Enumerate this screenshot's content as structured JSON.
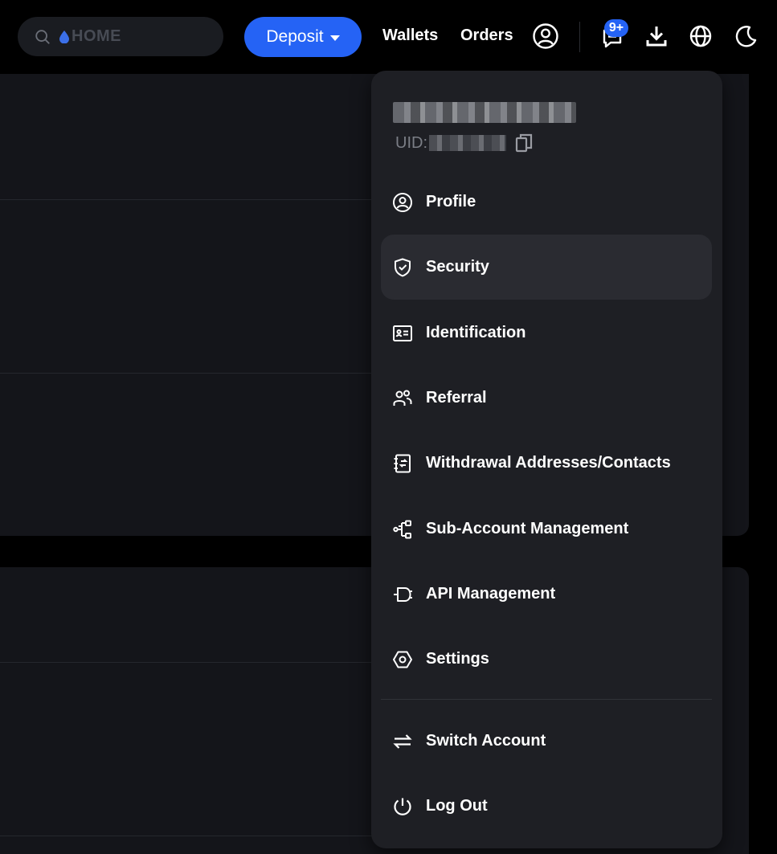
{
  "header": {
    "search_text": "HOME",
    "deposit_label": "Deposit",
    "nav": {
      "wallets": "Wallets",
      "orders": "Orders"
    },
    "notification_badge": "9+",
    "icons": [
      "search-icon",
      "drop-icon",
      "user-icon",
      "chat-icon",
      "download-icon",
      "globe-icon",
      "moon-icon"
    ],
    "accent_color": "#2563f5"
  },
  "menu": {
    "uid_label": "UID:",
    "items": [
      {
        "label": "Profile",
        "icon": "profile-icon"
      },
      {
        "label": "Security",
        "icon": "shield-icon",
        "active": true
      },
      {
        "label": "Identification",
        "icon": "id-card-icon"
      },
      {
        "label": "Referral",
        "icon": "users-icon"
      },
      {
        "label": "Withdrawal Addresses/Contacts",
        "icon": "address-book-icon"
      },
      {
        "label": "Sub-Account Management",
        "icon": "share-nodes-icon"
      },
      {
        "label": "API Management",
        "icon": "plug-icon"
      },
      {
        "label": "Settings",
        "icon": "hexagon-settings-icon"
      }
    ],
    "footer_items": [
      {
        "label": "Switch Account",
        "icon": "switch-arrows-icon"
      },
      {
        "label": "Log Out",
        "icon": "power-icon"
      }
    ]
  }
}
